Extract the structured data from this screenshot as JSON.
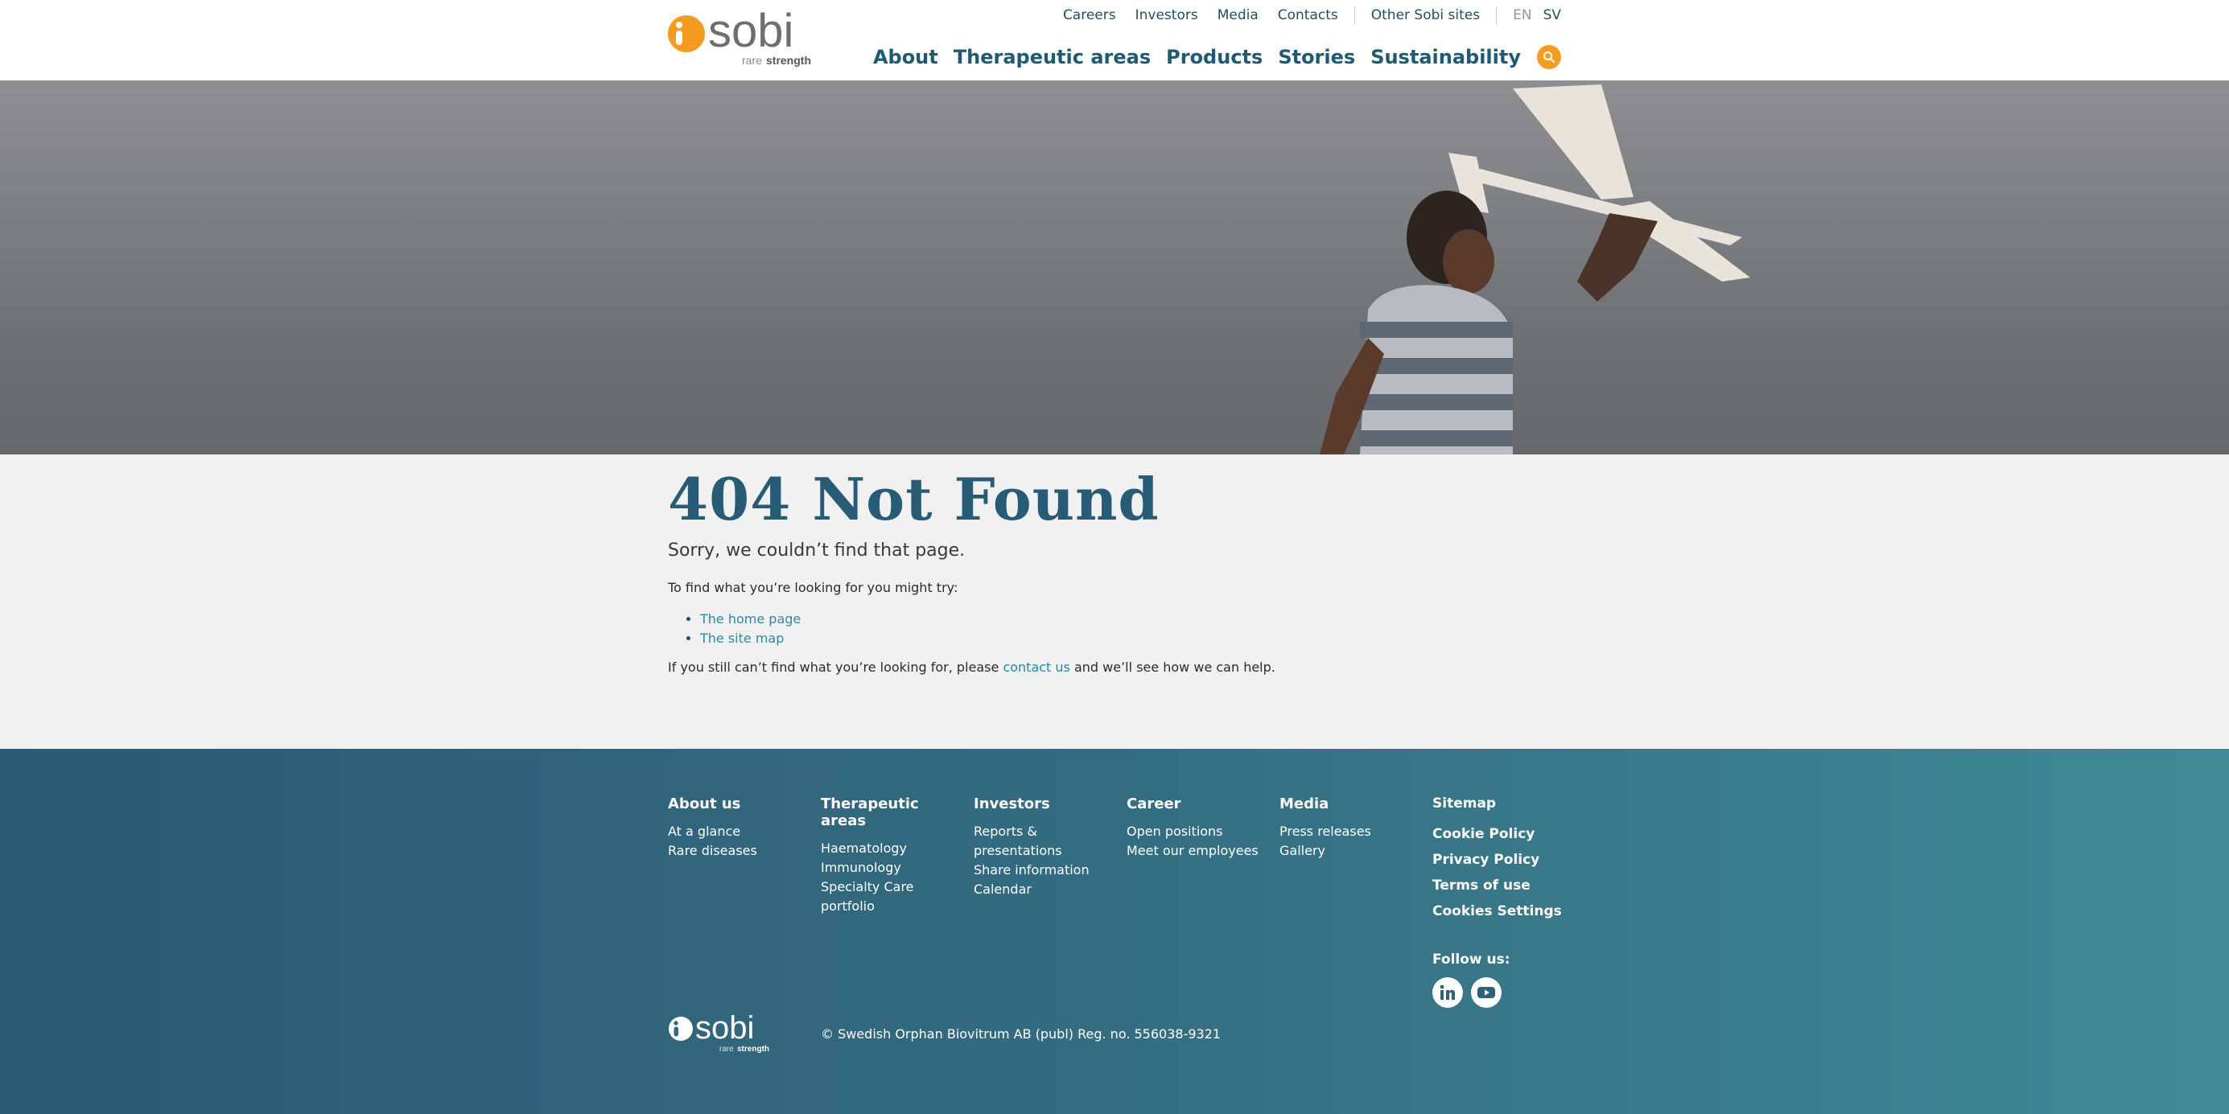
{
  "brand": {
    "name": "sobi",
    "tagline_light": "rare",
    "tagline_bold": "strength",
    "orange": "#f39c1f",
    "navy": "#1f5a72"
  },
  "header": {
    "utility_links": [
      "Careers",
      "Investors",
      "Media",
      "Contacts"
    ],
    "other_sites": "Other Sobi sites",
    "lang_en": "EN",
    "lang_sv": "SV",
    "main_nav": [
      "About",
      "Therapeutic areas",
      "Products",
      "Stories",
      "Sustainability"
    ],
    "search_icon": "search-icon"
  },
  "main": {
    "title": "404 Not Found",
    "sorry": "Sorry, we couldn’t find that page.",
    "try_text": "To find what you’re looking for you might try:",
    "suggestions": [
      "The home page",
      "The site map"
    ],
    "still_before": "If you still can’t find what you’re looking for, please ",
    "still_link": "contact us",
    "still_after": " and we’ll see how we can help."
  },
  "footer": {
    "columns": [
      {
        "heading": "About us",
        "links": [
          "At a glance",
          "Rare diseases"
        ]
      },
      {
        "heading": "Therapeutic areas",
        "links": [
          "Haematology",
          "Immunology",
          "Specialty Care portfolio"
        ]
      },
      {
        "heading": "Investors",
        "links": [
          "Reports & presentations",
          "Share information",
          "Calendar"
        ]
      },
      {
        "heading": "Career",
        "links": [
          "Open positions",
          "Meet our employees"
        ]
      },
      {
        "heading": "Media",
        "links": [
          "Press releases",
          "Gallery"
        ]
      }
    ],
    "side": {
      "sitemap": "Sitemap",
      "links": [
        "Cookie Policy",
        "Privacy Policy",
        "Terms of use",
        "Cookies Settings"
      ],
      "follow": "Follow us:",
      "social": [
        "linkedin-icon",
        "youtube-icon"
      ]
    },
    "copyright": "© Swedish Orphan Biovitrum AB (publ) Reg. no. 556038-9321"
  }
}
